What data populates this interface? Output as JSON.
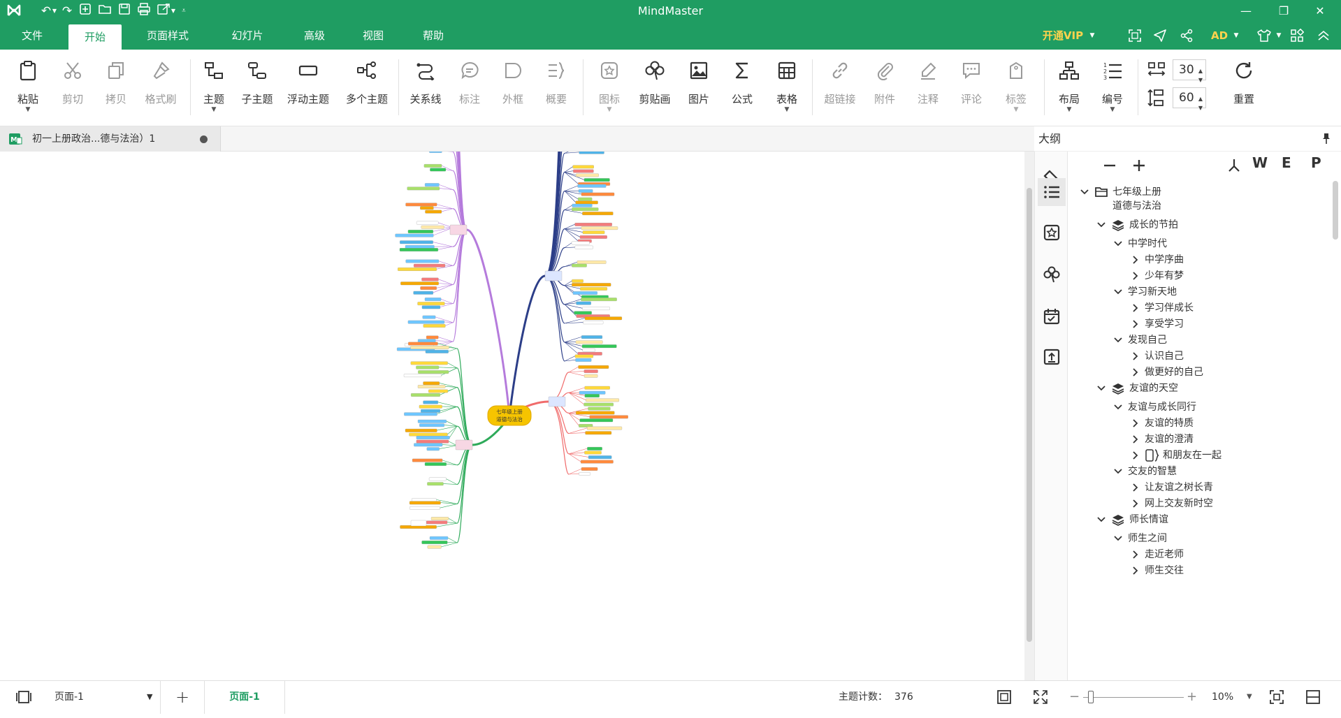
{
  "app": {
    "title": "MindMaster"
  },
  "menu": {
    "items": [
      "文件",
      "开始",
      "页面样式",
      "幻灯片",
      "高级",
      "视图",
      "帮助"
    ],
    "active": "开始",
    "vip_label": "开通VIP",
    "user_initials": "AD"
  },
  "ribbon": {
    "paste": "粘贴",
    "cut": "剪切",
    "copy": "拷贝",
    "format_painter": "格式刷",
    "topic": "主题",
    "subtopic": "子主题",
    "floating_topic": "浮动主题",
    "multiple_topics": "多个主题",
    "relationship": "关系线",
    "callout": "标注",
    "boundary": "外框",
    "summary": "概要",
    "icon": "图标",
    "clipart": "剪贴画",
    "picture": "图片",
    "formula": "公式",
    "table": "表格",
    "hyperlink": "超链接",
    "attachment": "附件",
    "note": "注释",
    "comment": "评论",
    "tag": "标签",
    "layout": "布局",
    "numbering": "编号",
    "reset": "重置",
    "h_spacing": "30",
    "v_spacing": "60"
  },
  "document": {
    "tab_title": "初一上册政治...德与法治）1"
  },
  "mindmap": {
    "root_line1": "七年级上册",
    "root_line2": "道德与法治"
  },
  "outline": {
    "title": "大纲",
    "format_labels": [
      "W",
      "E",
      "P"
    ],
    "rows": [
      {
        "text": "七年级上册",
        "text2": "道德与法治",
        "level": 0,
        "expanded": true
      },
      {
        "text": "成长的节拍",
        "level": 1,
        "expanded": true
      },
      {
        "text": "中学时代",
        "level": 2,
        "expanded": true
      },
      {
        "text": "中学序曲",
        "level": 3,
        "expanded": false
      },
      {
        "text": "少年有梦",
        "level": 3,
        "expanded": false
      },
      {
        "text": "学习新天地",
        "level": 2,
        "expanded": true
      },
      {
        "text": "学习伴成长",
        "level": 3,
        "expanded": false
      },
      {
        "text": "享受学习",
        "level": 3,
        "expanded": false
      },
      {
        "text": "发现自己",
        "level": 2,
        "expanded": true
      },
      {
        "text": "认识自己",
        "level": 3,
        "expanded": false
      },
      {
        "text": "做更好的自己",
        "level": 3,
        "expanded": false
      },
      {
        "text": "友谊的天空",
        "level": 1,
        "expanded": true
      },
      {
        "text": "友谊与成长同行",
        "level": 2,
        "expanded": true
      },
      {
        "text": "友谊的特质",
        "level": 3,
        "expanded": false
      },
      {
        "text": "友谊的澄清",
        "level": 3,
        "expanded": false
      },
      {
        "text": "和朋友在一起",
        "level": 3,
        "expanded": false
      },
      {
        "text": "交友的智慧",
        "level": 2,
        "expanded": true
      },
      {
        "text": "让友谊之树长青",
        "level": 3,
        "expanded": false
      },
      {
        "text": "网上交友新时空",
        "level": 3,
        "expanded": false
      },
      {
        "text": "师长情谊",
        "level": 1,
        "expanded": true
      },
      {
        "text": "师生之间",
        "level": 2,
        "expanded": true
      },
      {
        "text": "走近老师",
        "level": 3,
        "expanded": false
      },
      {
        "text": "师生交往",
        "level": 3,
        "expanded": false
      }
    ]
  },
  "status": {
    "page_select": "页面-1",
    "page_tab": "页面-1",
    "topic_count_label": "主题计数：",
    "topic_count": "376",
    "zoom": "10%",
    "zoom_fraction": 0.05
  },
  "colors": {
    "brand": "#1f9d62",
    "vip": "#ffd34d"
  }
}
